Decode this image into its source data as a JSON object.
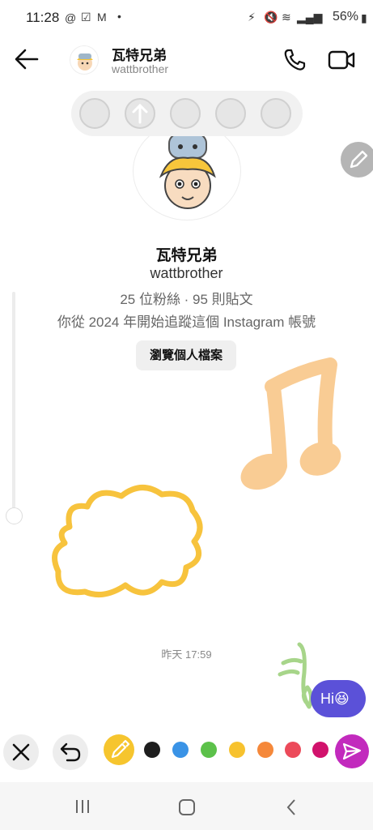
{
  "status_bar": {
    "time": "11:28",
    "battery": "56%"
  },
  "header": {
    "name": "瓦特兄弟",
    "handle": "wattbrother"
  },
  "profile": {
    "name": "瓦特兄弟",
    "handle": "wattbrother",
    "stats": "25 位粉絲 · 95 則貼文",
    "since": "你從 2024 年開始追蹤這個 Instagram 帳號",
    "view_profile_label": "瀏覽個人檔案"
  },
  "messages": {
    "timestamp": "昨天 17:59",
    "sent_text": "Hi😆"
  },
  "toolbar": {
    "colors": [
      "#1e1e1e",
      "#3a93e6",
      "#5cc14a",
      "#f7c22e",
      "#f5883a",
      "#ec4a5a",
      "#d1126c"
    ],
    "accent": "#c22abd",
    "bubble_color": "#5b51d8"
  },
  "icons": {
    "back": "back-arrow-icon",
    "call": "phone-icon",
    "video": "video-camera-icon",
    "close": "close-icon",
    "undo": "undo-icon",
    "eyedropper": "eyedropper-icon",
    "send": "send-icon",
    "pencil": "pencil-icon"
  }
}
